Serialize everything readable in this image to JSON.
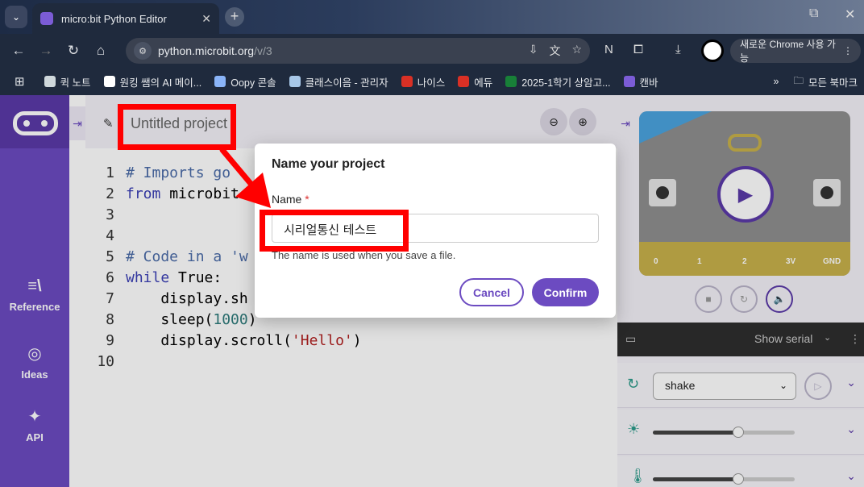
{
  "browser": {
    "tab_title": "micro:bit Python Editor",
    "url_host": "python.microbit.org",
    "url_path": "/v/3",
    "update_chip": "새로운 Chrome 사용 가능",
    "bookmarks": [
      {
        "label": "퀵 노트",
        "color": "#cfd8dc"
      },
      {
        "label": "원킹 쌤의 AI 메이...",
        "color": "#ffffff"
      },
      {
        "label": "Oopy 콘솔",
        "color": "#8ab4f8"
      },
      {
        "label": "클래스이음 - 관리자",
        "color": "#a7c7e7"
      },
      {
        "label": "나이스",
        "color": "#d93025"
      },
      {
        "label": "에듀",
        "color": "#d93025"
      },
      {
        "label": "2025-1학기 상암고...",
        "color": "#188038"
      },
      {
        "label": "캔바",
        "color": "#7b5cd6"
      }
    ],
    "all_bookmarks": "모든 북마크"
  },
  "sidebar": {
    "items": [
      {
        "label": "Reference",
        "icon": "book-icon",
        "glyph": "≡\\"
      },
      {
        "label": "Ideas",
        "icon": "lightbulb-icon",
        "glyph": "💡"
      },
      {
        "label": "API",
        "icon": "python-icon",
        "glyph": "✦"
      }
    ]
  },
  "editor": {
    "project_name": "Untitled project",
    "lines": [
      {
        "n": "1",
        "parts": [
          {
            "t": "# Imports go",
            "c": "cmt"
          }
        ]
      },
      {
        "n": "2",
        "parts": [
          {
            "t": "from",
            "c": "kw"
          },
          {
            "t": " microbit",
            "c": ""
          }
        ]
      },
      {
        "n": "3",
        "parts": []
      },
      {
        "n": "4",
        "parts": []
      },
      {
        "n": "5",
        "parts": [
          {
            "t": "# Code in a 'w",
            "c": "cmt"
          }
        ]
      },
      {
        "n": "6",
        "parts": [
          {
            "t": "while",
            "c": "kw"
          },
          {
            "t": " True:",
            "c": ""
          }
        ]
      },
      {
        "n": "7",
        "parts": [
          {
            "t": "    display.sh",
            "c": ""
          }
        ]
      },
      {
        "n": "8",
        "parts": [
          {
            "t": "    sleep(",
            "c": ""
          },
          {
            "t": "1000",
            "c": "num"
          },
          {
            "t": ")",
            "c": ""
          }
        ]
      },
      {
        "n": "9",
        "parts": [
          {
            "t": "    display.scroll(",
            "c": ""
          },
          {
            "t": "'Hello'",
            "c": "str"
          },
          {
            "t": ")",
            "c": ""
          }
        ]
      },
      {
        "n": "10",
        "parts": []
      }
    ]
  },
  "simulator": {
    "pins": [
      "0",
      "1",
      "2",
      "3V",
      "GND"
    ],
    "show_serial": "Show serial",
    "gesture": "shake",
    "light_level": 0.6,
    "temperature_level": 0.6
  },
  "dialog": {
    "title": "Name your project",
    "name_label": "Name",
    "required_mark": "*",
    "name_value": "시리얼통신 테스트",
    "help": "The name is used when you save a file.",
    "cancel": "Cancel",
    "confirm": "Confirm"
  },
  "colors": {
    "accent": "#6c4bc1",
    "annotation": "#ff0000"
  }
}
